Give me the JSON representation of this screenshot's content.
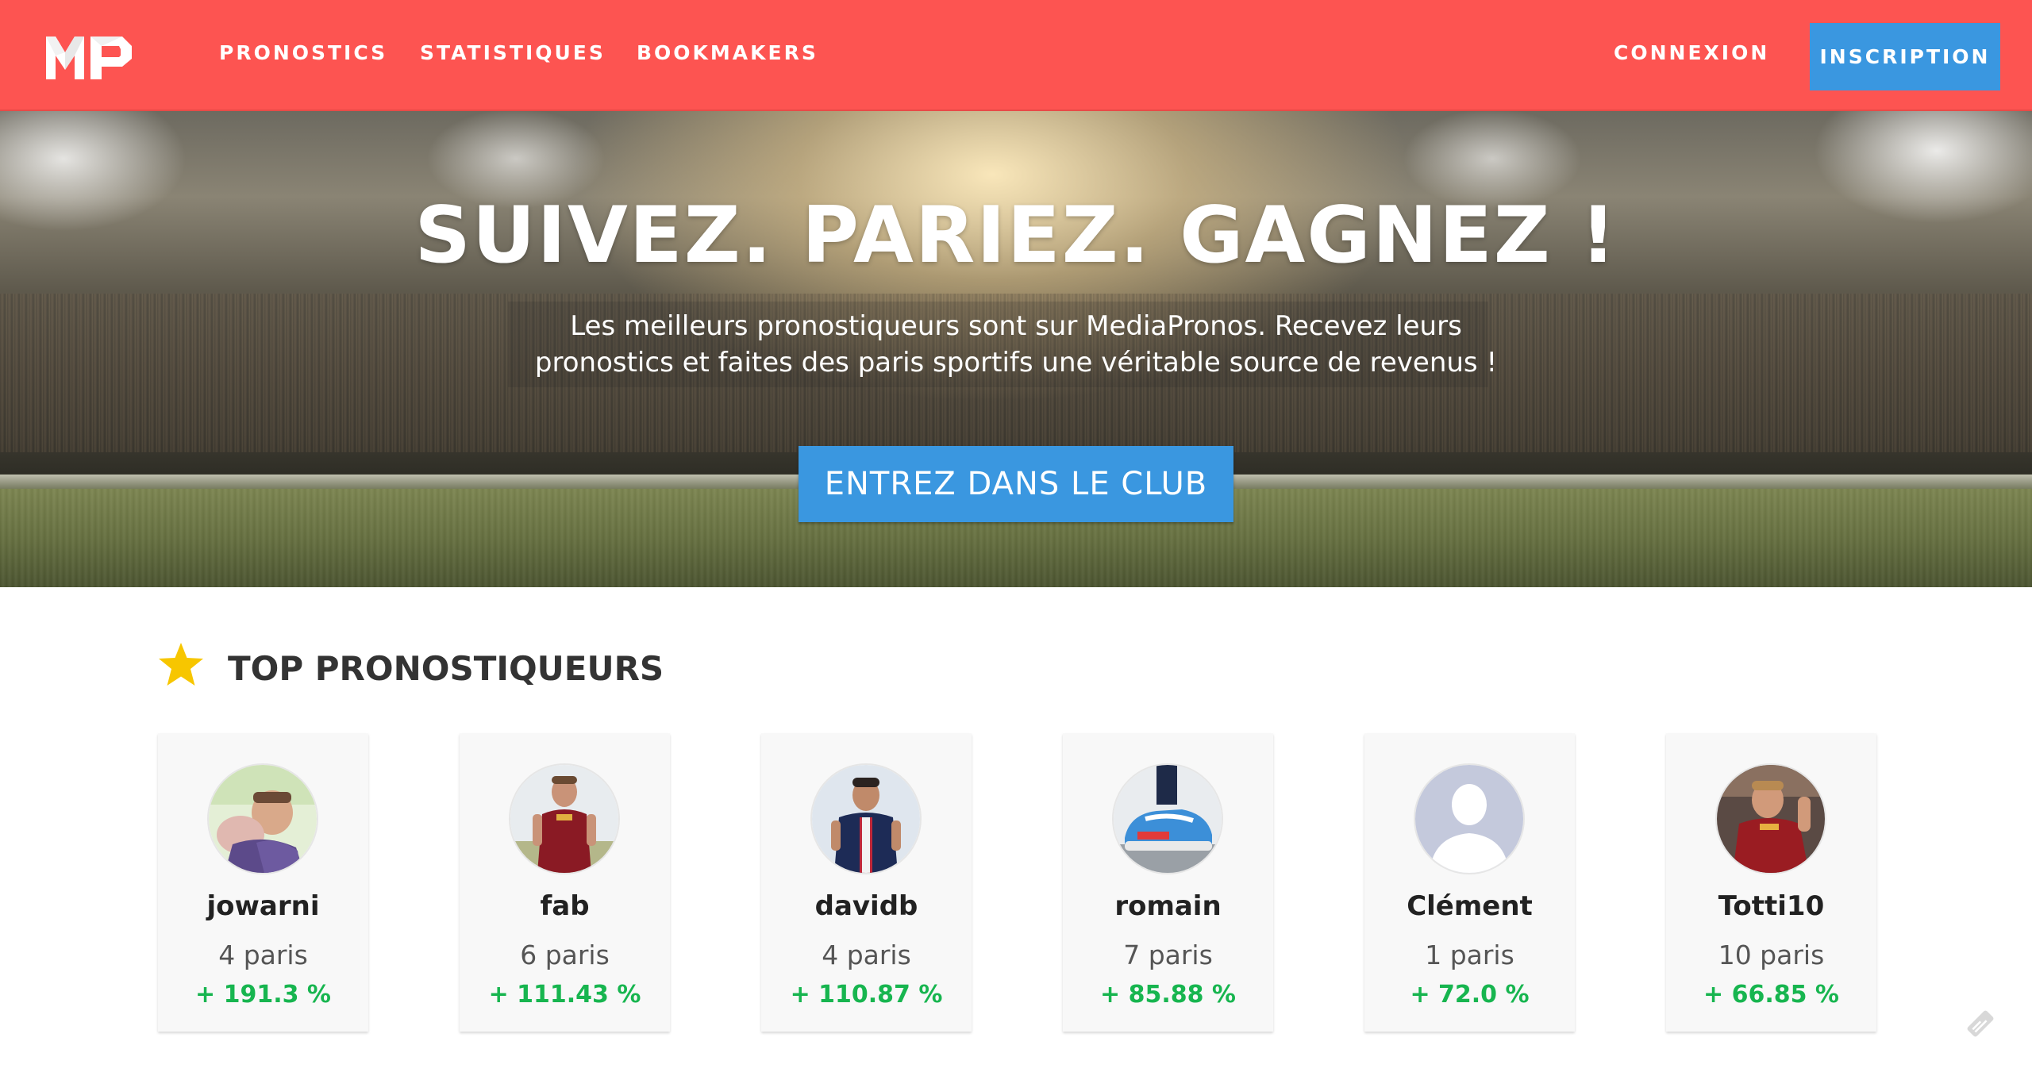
{
  "navbar": {
    "logo_text": "MP",
    "links": {
      "pronostics": "PRONOSTICS",
      "statistiques": "STATISTIQUES",
      "bookmakers": "BOOKMAKERS"
    },
    "connexion": "CONNEXION",
    "inscription": "INSCRIPTION",
    "color": "#fd5451"
  },
  "hero": {
    "title": "SUIVEZ. PARIEZ. GAGNEZ !",
    "subtitle_line1": "Les meilleurs pronostiqueurs sont sur MediaPronos. Recevez leurs",
    "subtitle_line2": "pronostics et faites des paris sportifs une véritable source de revenus !",
    "cta": "ENTREZ DANS LE CLUB"
  },
  "top_section": {
    "icon": "star-icon",
    "title": "TOP PRONOSTIQUEURS",
    "cards": [
      {
        "name": "jowarni",
        "bets": "4 paris",
        "score": "+ 191.3 %"
      },
      {
        "name": "fab",
        "bets": "6 paris",
        "score": "+ 111.43 %"
      },
      {
        "name": "davidb",
        "bets": "4 paris",
        "score": "+ 110.87 %"
      },
      {
        "name": "romain",
        "bets": "7 paris",
        "score": "+ 85.88 %"
      },
      {
        "name": "Clément",
        "bets": "1 paris",
        "score": "+ 72.0 %"
      },
      {
        "name": "Totti10",
        "bets": "10 paris",
        "score": "+ 66.85 %"
      }
    ]
  },
  "colors": {
    "accent_blue": "#3a97e0",
    "positive_green": "#17b54f",
    "star_yellow": "#f7c600"
  }
}
